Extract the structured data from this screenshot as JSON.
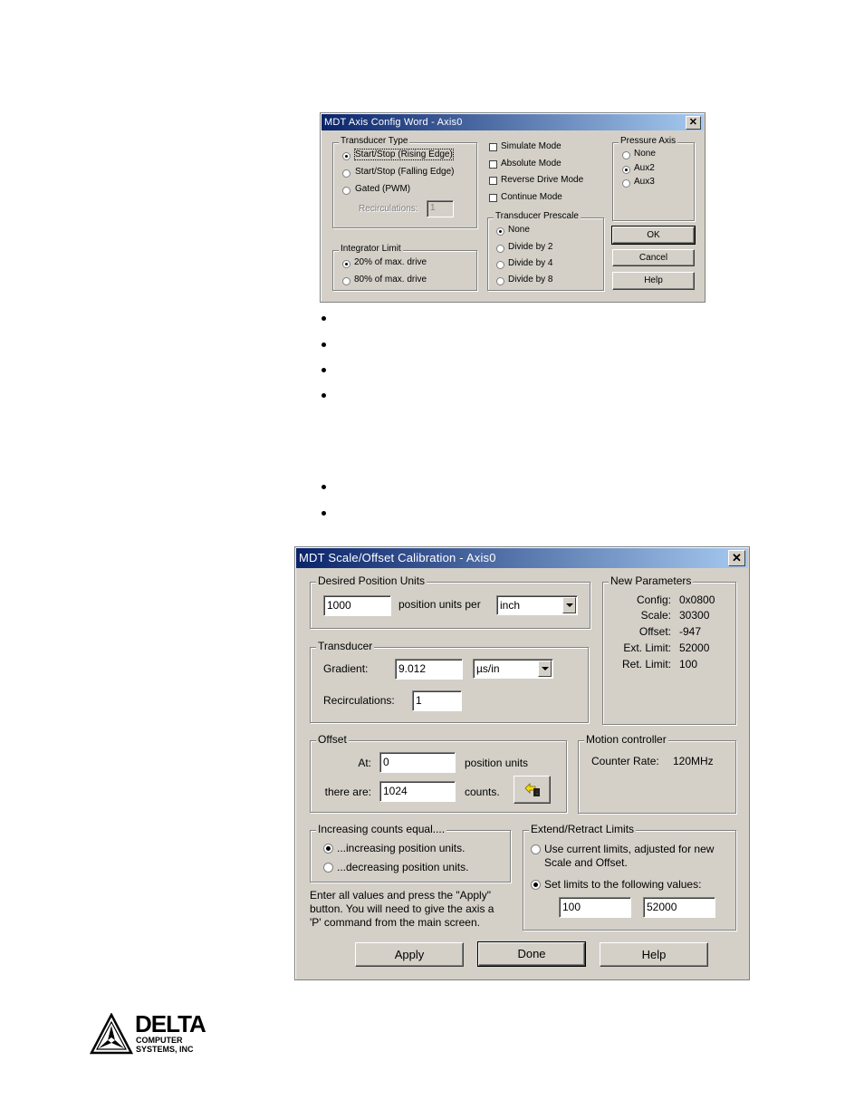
{
  "dialog1": {
    "title": "MDT Axis Config Word - Axis0",
    "close": "✕",
    "transducer_type": {
      "legend": "Transducer Type",
      "options": [
        "Start/Stop (Rising Edge)",
        "Start/Stop (Falling Edge)",
        "Gated (PWM)"
      ],
      "selected": 0,
      "recirculations_label": "Recirculations:",
      "recirculations_value": "1"
    },
    "checkboxes": [
      "Simulate Mode",
      "Absolute Mode",
      "Reverse Drive Mode",
      "Continue Mode"
    ],
    "pressure_axis": {
      "legend": "Pressure Axis",
      "options": [
        "None",
        "Aux2",
        "Aux3"
      ],
      "selected": 1
    },
    "integrator_limit": {
      "legend": "Integrator Limit",
      "options": [
        "20% of max. drive",
        "80% of max. drive"
      ],
      "selected": 0
    },
    "prescale": {
      "legend": "Transducer Prescale",
      "options": [
        "None",
        "Divide by 2",
        "Divide by 4",
        "Divide by 8"
      ],
      "selected": 0
    },
    "buttons": {
      "ok": "OK",
      "cancel": "Cancel",
      "help": "Help"
    }
  },
  "dialog2": {
    "title": "MDT Scale/Offset Calibration - Axis0",
    "close": "✕",
    "position_units": {
      "legend": "Desired Position Units",
      "value": "1000",
      "label": "position units per",
      "unit": "inch"
    },
    "transducer": {
      "legend": "Transducer",
      "gradient_label": "Gradient:",
      "gradient_value": "9.012",
      "gradient_unit": "µs/in",
      "recirculations_label": "Recirculations:",
      "recirculations_value": "1"
    },
    "new_parameters": {
      "legend": "New Parameters",
      "rows": [
        {
          "label": "Config:",
          "value": "0x0800"
        },
        {
          "label": "Scale:",
          "value": "30300"
        },
        {
          "label": "Offset:",
          "value": "-947"
        },
        {
          "label": "Ext. Limit:",
          "value": "52000"
        },
        {
          "label": "Ret. Limit:",
          "value": "100"
        }
      ]
    },
    "offset": {
      "legend": "Offset",
      "at_label": "At:",
      "at_value": "0",
      "at_unit": "position units",
      "there_label": "there are:",
      "there_value": "1024",
      "there_unit": "counts."
    },
    "motion_controller": {
      "legend": "Motion controller",
      "counter_rate_label": "Counter Rate:",
      "counter_rate_value": "120MHz"
    },
    "increasing_counts": {
      "legend": "Increasing counts equal....",
      "options": [
        "...increasing position units.",
        "...decreasing position units."
      ],
      "selected": 0
    },
    "instructions": [
      "Enter all values and press the \"Apply\"",
      "button.  You will need to give the axis a",
      "'P' command from the main screen."
    ],
    "limits": {
      "legend": "Extend/Retract Limits",
      "option1_line1": "Use current limits, adjusted for new",
      "option1_line2": "Scale and Offset.",
      "option2": "Set limits to the following values:",
      "selected": 1,
      "retract_value": "100",
      "extend_value": "52000"
    },
    "buttons": {
      "apply": "Apply",
      "done": "Done",
      "help": "Help"
    }
  },
  "logo": {
    "name": "DELTA",
    "line2": "COMPUTER",
    "line3": "SYSTEMS, INC"
  }
}
